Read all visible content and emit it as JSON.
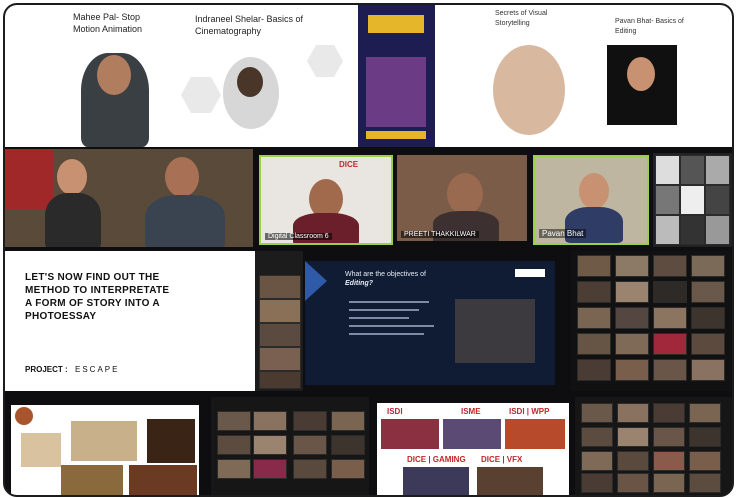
{
  "row1": {
    "speaker1": "Mahee Pal- Stop Motion Animation",
    "speaker2": "Indraneel Shelar- Basics of Cinematography",
    "speaker3": "Secrets of Visual Storytelling",
    "speaker4": "Pavan Bhat- Basics of Editing"
  },
  "row2": {
    "dice_logo": "DICE",
    "label_classroom": "Digital Classroom 6",
    "label_preeti": "PREETI THAKKILWAR",
    "label_pavan": "Pavan Bhat"
  },
  "row3": {
    "photoessay_title": "LET'S NOW FIND OUT THE METHOD TO INTERPRETATE A FORM OF STORY INTO A PHOTOESSAY",
    "project_label": "PROJECT :",
    "project_name": "ESCAPE",
    "slide_heading": "What are the objectives of",
    "slide_heading_em": "Editing?"
  },
  "row4": {
    "isdi_1": "ISDI",
    "isme": "ISME",
    "isdi_wpp": "ISDI | WPP",
    "dice_gaming": "DICE | GAMING",
    "dice_vfx": "DICE | VFX"
  },
  "colors": {
    "slide_bg": "#0f1c33",
    "slide_accent": "#2e5aa8",
    "green_border": "#9bd04b",
    "isdi_red": "#c0262d"
  }
}
